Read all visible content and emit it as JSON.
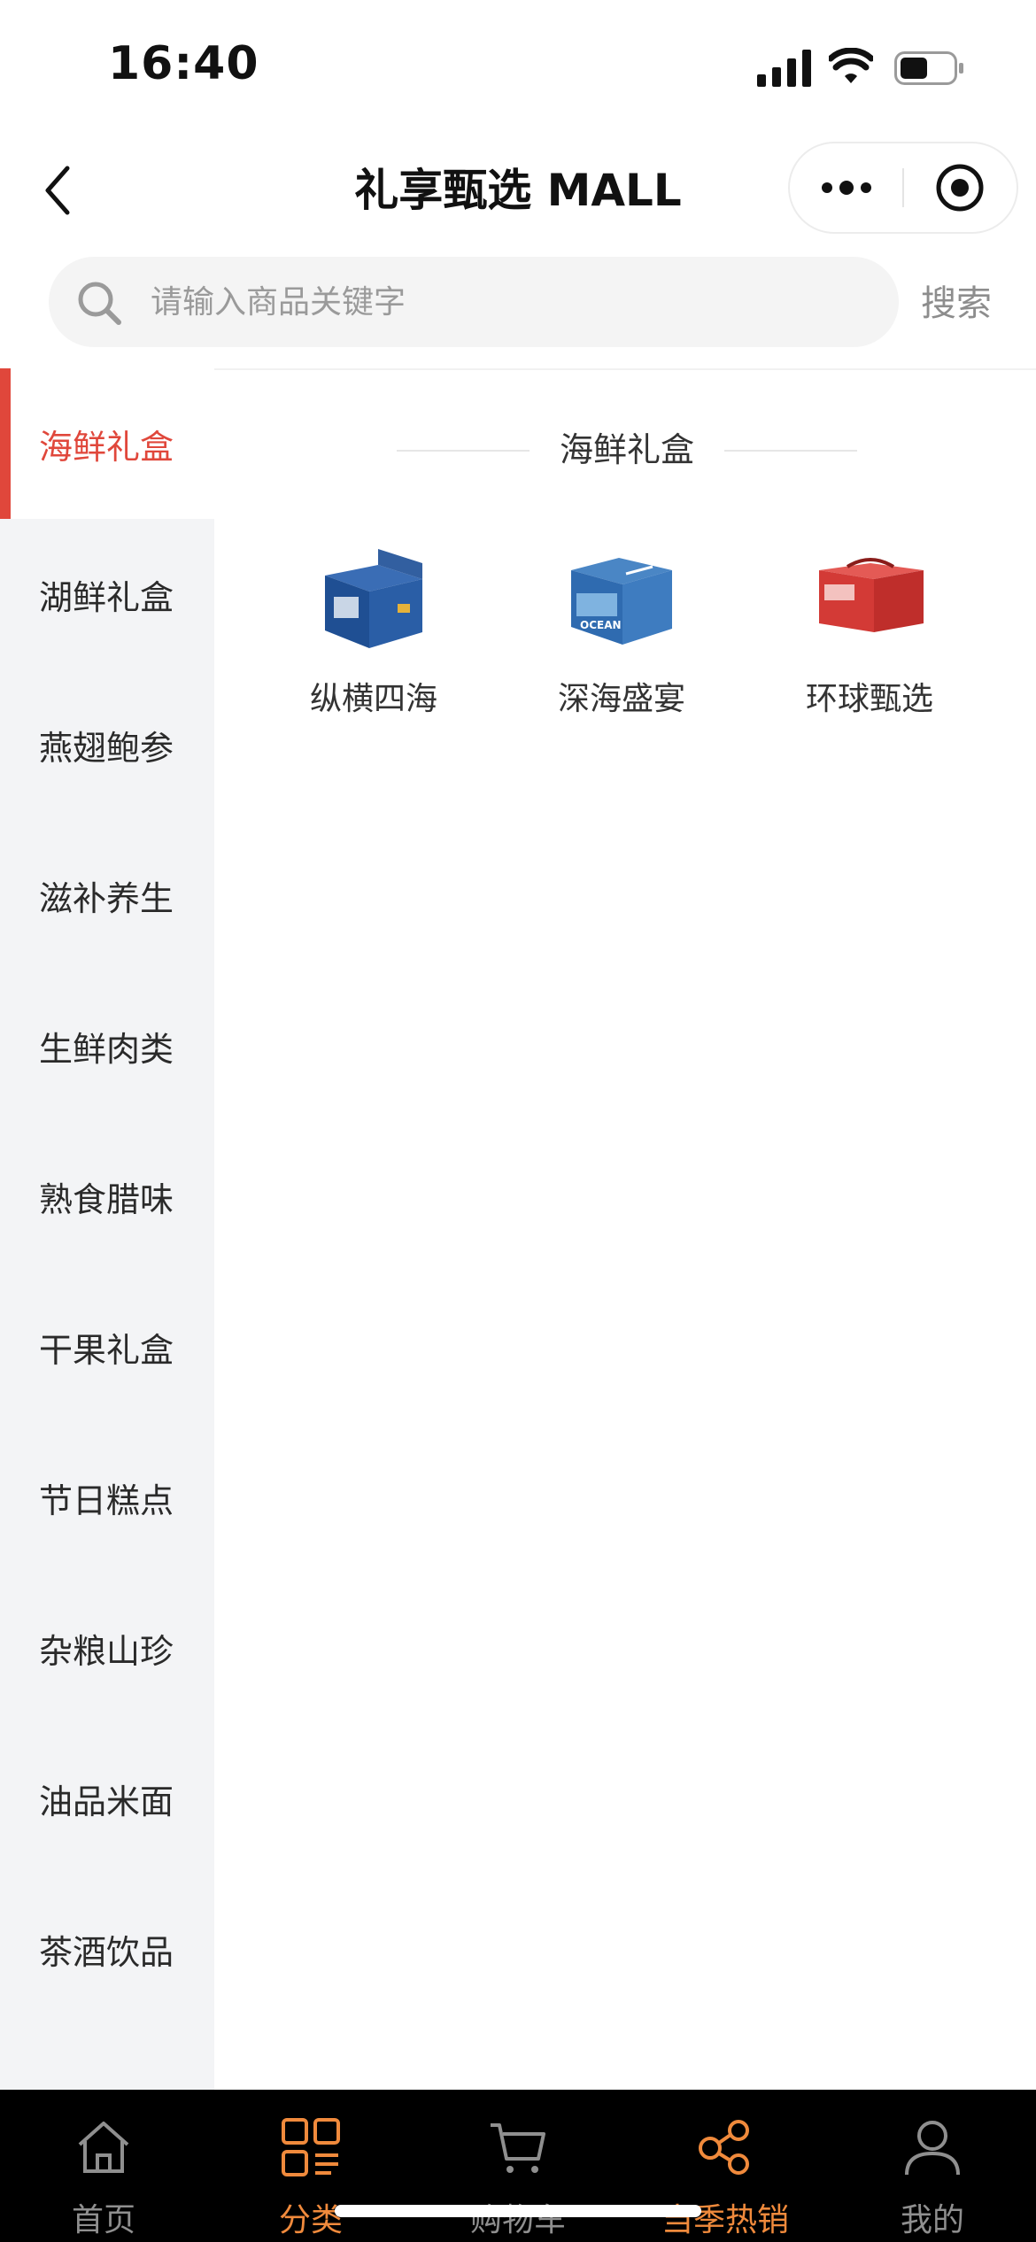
{
  "status": {
    "time": "16:40"
  },
  "nav": {
    "title": "礼享甄选 MALL"
  },
  "search": {
    "placeholder": "请输入商品关键字",
    "button_label": "搜索"
  },
  "sidebar": {
    "items": [
      {
        "label": "海鲜礼盒",
        "active": true
      },
      {
        "label": "湖鲜礼盒"
      },
      {
        "label": "燕翅鲍参"
      },
      {
        "label": "滋补养生"
      },
      {
        "label": "生鲜肉类"
      },
      {
        "label": "熟食腊味"
      },
      {
        "label": "干果礼盒"
      },
      {
        "label": "节日糕点"
      },
      {
        "label": "杂粮山珍"
      },
      {
        "label": "油品米面"
      },
      {
        "label": "茶酒饮品"
      }
    ]
  },
  "content": {
    "section_title": "海鲜礼盒",
    "products": [
      {
        "name": "纵横四海",
        "icon": "blue-gift-box"
      },
      {
        "name": "深海盛宴",
        "icon": "ocean-gift-box"
      },
      {
        "name": "环球甄选",
        "icon": "red-cooler-bag"
      }
    ]
  },
  "tabbar": {
    "tabs": [
      {
        "label": "首页",
        "icon": "home-icon"
      },
      {
        "label": "分类",
        "icon": "category-icon",
        "active": true
      },
      {
        "label": "购物车",
        "icon": "cart-icon"
      },
      {
        "label": "当季热销",
        "icon": "share-icon",
        "highlight": true
      },
      {
        "label": "我的",
        "icon": "user-icon"
      }
    ]
  },
  "colors": {
    "accent": "#e0473b",
    "tab_active": "#f08a3c",
    "sidebar_bg": "#f3f4f6",
    "tabbar_bg": "#000000"
  }
}
